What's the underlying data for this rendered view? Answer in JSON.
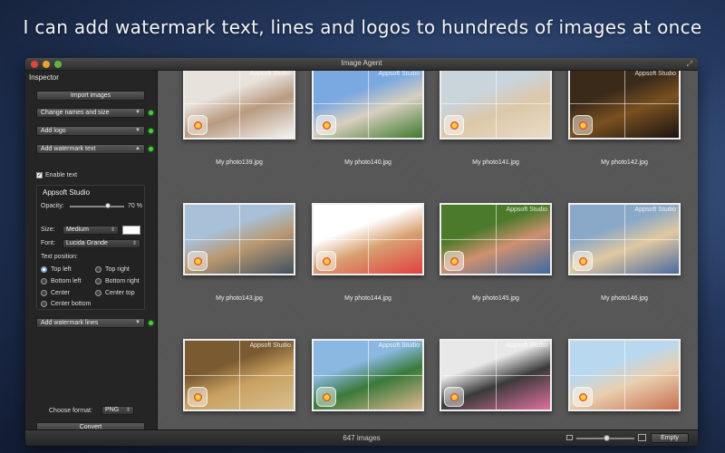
{
  "headline": "I can add watermark text, lines and logos to hundreds of images at once",
  "window": {
    "title": "Image Agent"
  },
  "inspector": {
    "title": "Inspector",
    "import_label": "Import images",
    "change_names_label": "Change names and size",
    "add_logo_label": "Add logo",
    "add_watermark_text_label": "Add watermark text",
    "enable_text_label": "Enable text",
    "enable_text_checked": true,
    "watermark": {
      "text": "Appsoft Studio",
      "opacity_label": "Opacity:",
      "opacity_value": "70 %",
      "opacity_fraction": 0.7,
      "size_label": "Size:",
      "size_value": "Medium",
      "font_label": "Font:",
      "font_value": "Lucida Grande",
      "position_label": "Text position:",
      "positions": [
        "Top left",
        "Top right",
        "Bottom left",
        "Bottom right",
        "Center",
        "Center top",
        "Center bottom"
      ],
      "selected_position": "Top left"
    },
    "add_watermark_lines_label": "Add watermark lines",
    "format_label": "Choose format:",
    "format_value": "PNG",
    "convert_label": "Convert"
  },
  "thumbnails": [
    {
      "caption": "My photo139.jpg",
      "watermark": "Appsoft Studio",
      "colors": [
        "#e8e2dc",
        "#b89a80",
        "#f5f5f5"
      ]
    },
    {
      "caption": "My photo140.jpg",
      "watermark": "Appsoft Studio",
      "colors": [
        "#7aa8e0",
        "#d8cfc0",
        "#3f7a2c"
      ]
    },
    {
      "caption": "My photo141.jpg",
      "watermark": "",
      "colors": [
        "#c9d4db",
        "#dcc8a8",
        "#e9dcc6"
      ]
    },
    {
      "caption": "My photo142.jpg",
      "watermark": "Appsoft Studio",
      "colors": [
        "#3a2a1a",
        "#7a5020",
        "#1a1410"
      ]
    },
    {
      "caption": "My photo143.jpg",
      "watermark": "",
      "colors": [
        "#a8c0d8",
        "#b89870",
        "#405060"
      ]
    },
    {
      "caption": "My photo144.jpg",
      "watermark": "",
      "colors": [
        "#ffffff",
        "#d8a070",
        "#e04040"
      ]
    },
    {
      "caption": "My photo145.jpg",
      "watermark": "Appsoft Studio",
      "colors": [
        "#4a7a2a",
        "#d09070",
        "#3a6aa0"
      ]
    },
    {
      "caption": "My photo146.jpg",
      "watermark": "Appsoft Studio",
      "colors": [
        "#8aa8c8",
        "#e0c8a0",
        "#4a6aa0"
      ]
    },
    {
      "caption": "",
      "watermark": "Appsoft Studio",
      "colors": [
        "#7a5a30",
        "#c8a060",
        "#d8c090"
      ]
    },
    {
      "caption": "",
      "watermark": "Appsoft Studio",
      "colors": [
        "#8ab8e0",
        "#3a7a3a",
        "#e0b890"
      ]
    },
    {
      "caption": "",
      "watermark": "Appsoft Studio",
      "colors": [
        "#e8e8e8",
        "#3a3a3a",
        "#e070a0"
      ]
    },
    {
      "caption": "",
      "watermark": "",
      "colors": [
        "#b8d8f0",
        "#e8d0b0",
        "#c87050"
      ]
    }
  ],
  "statusbar": {
    "count": "647 images",
    "empty_label": "Empty"
  }
}
